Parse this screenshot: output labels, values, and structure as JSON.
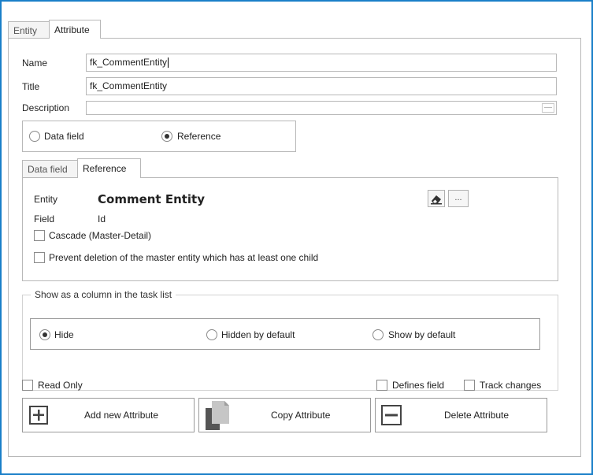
{
  "tabs": {
    "entity": "Entity",
    "attribute": "Attribute"
  },
  "fields": {
    "name_label": "Name",
    "name_value": "fk_CommentEntity",
    "title_label": "Title",
    "title_value": "fk_CommentEntity",
    "description_label": "Description",
    "description_value": ""
  },
  "field_type": {
    "data_field_label": "Data field",
    "reference_label": "Reference",
    "selected": "reference"
  },
  "subtabs": {
    "data_field": "Data field",
    "reference": "Reference"
  },
  "reference": {
    "entity_label": "Entity",
    "entity_value": "Comment Entity",
    "field_label": "Field",
    "field_value": "Id",
    "cascade_label": "Cascade (Master-Detail)",
    "prevent_label": "Prevent deletion of the master entity which has at least one child",
    "browse_label": "..."
  },
  "task_list": {
    "legend": "Show as a column in the task list",
    "options": [
      "Hide",
      "Hidden by default",
      "Show by default"
    ],
    "selected": "Hide"
  },
  "bottom_options": {
    "read_only": "Read Only",
    "defines_field": "Defines field",
    "track_changes": "Track changes"
  },
  "actions": {
    "add": "Add new Attribute",
    "copy": "Copy Attribute",
    "delete": "Delete Attribute"
  },
  "colors": {
    "frame_border": "#1a7fc8"
  }
}
